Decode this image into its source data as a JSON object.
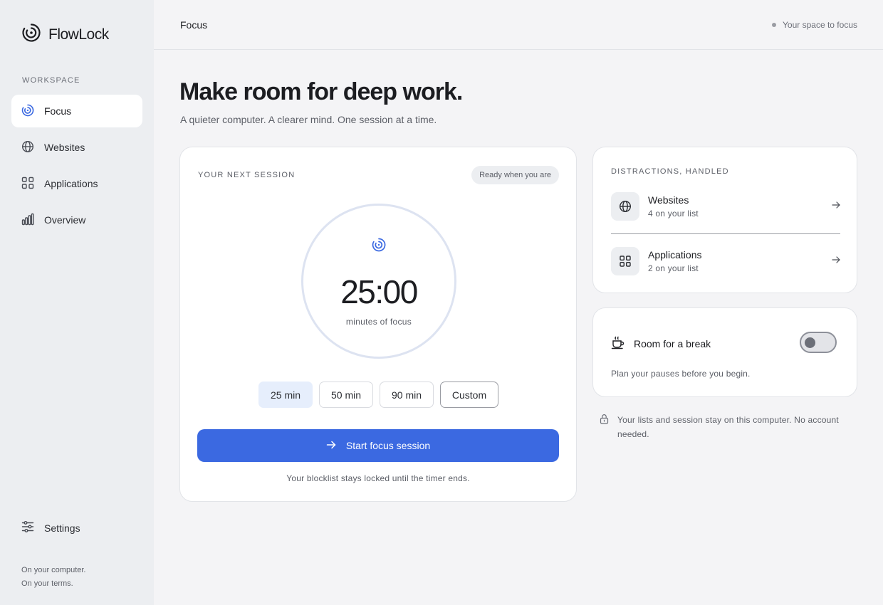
{
  "app": {
    "name": "FlowLock"
  },
  "sidebar": {
    "section_label": "WORKSPACE",
    "items": [
      {
        "label": "Focus",
        "icon": "focus-spiral-icon",
        "active": true
      },
      {
        "label": "Websites",
        "icon": "globe-icon"
      },
      {
        "label": "Applications",
        "icon": "grid-icon"
      },
      {
        "label": "Overview",
        "icon": "bar-chart-icon"
      }
    ],
    "settings_label": "Settings",
    "footer_line1": "On your computer.",
    "footer_line2": "On your terms."
  },
  "topbar": {
    "title": "Focus",
    "status": "Your space to focus"
  },
  "hero": {
    "headline": "Make room for deep work.",
    "subhead": "A quieter computer. A clearer mind. One session at a time."
  },
  "session": {
    "label": "YOUR NEXT SESSION",
    "pill": "Ready when you are",
    "timer_value": "25:00",
    "timer_caption": "minutes of focus",
    "durations": [
      "25 min",
      "50 min",
      "90 min",
      "Custom"
    ],
    "selected_duration": "25 min",
    "start_label": "Start focus session",
    "note": "Your blocklist stays locked until the timer ends."
  },
  "distractions": {
    "label": "DISTRACTIONS, HANDLED",
    "rows": [
      {
        "title": "Websites",
        "sub": "4 on your list",
        "icon": "globe-icon"
      },
      {
        "title": "Applications",
        "sub": "2 on your list",
        "icon": "grid-icon"
      }
    ]
  },
  "break": {
    "title": "Room for a break",
    "note": "Plan your pauses before you begin.",
    "enabled": false
  },
  "privacy": {
    "text": "Your lists and session stay on this computer. No account needed."
  },
  "colors": {
    "accent": "#3b69e1",
    "selected_chip": "#e6eefc",
    "sidebar_bg": "#eceef1",
    "page_bg": "#f4f4f6"
  }
}
